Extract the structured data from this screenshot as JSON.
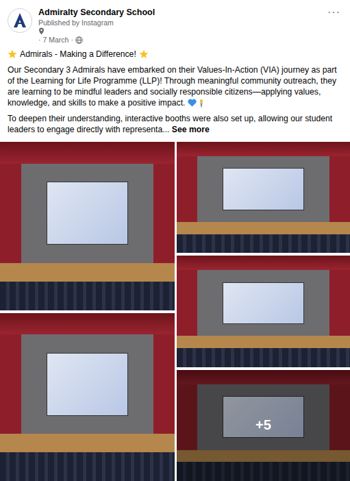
{
  "page": {
    "name": "Admiralty Secondary School",
    "published_by": "Published by Instagram",
    "separator": "·",
    "date": "7 March",
    "menu": "···"
  },
  "post": {
    "title": "Admirals - Making a Difference!",
    "paragraph1": "Our Secondary 3 Admirals have embarked on their Values-In-Action (VIA) journey as part of the Learning for Life Programme (LLP)! Through meaningful community outreach, they are learning to be mindful leaders and socially responsible citizens—applying values, knowledge, and skills to make a positive impact.",
    "paragraph2": "To deepen their understanding, interactive booths were also set up, allowing our student leaders to engage directly with representa... ",
    "see_more": "See more"
  },
  "photos": [
    {
      "more": false
    },
    {
      "more": false
    },
    {
      "more": false
    },
    {
      "more": false
    },
    {
      "more": true
    }
  ],
  "more_photos": "+5"
}
